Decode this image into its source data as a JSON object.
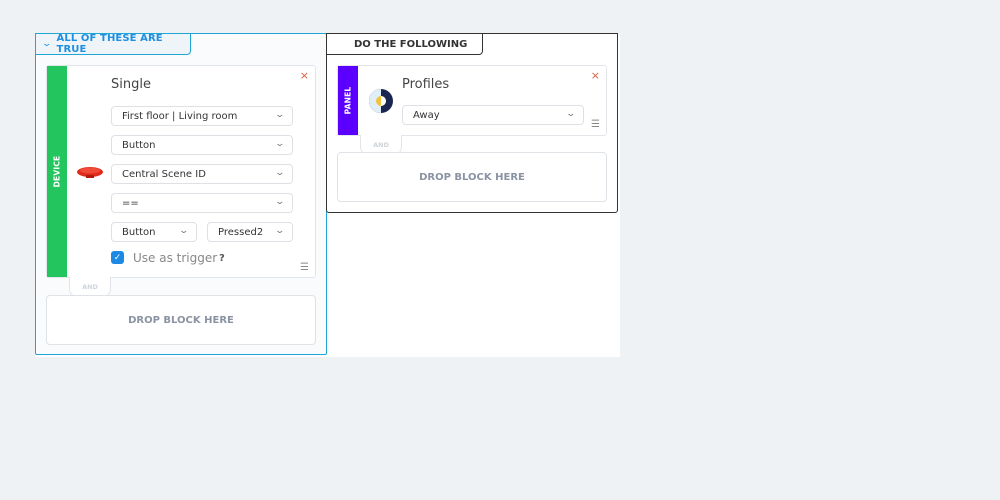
{
  "condition_group": {
    "label": "ALL OF THESE ARE TRUE",
    "toggle_icon": "chevron-down-icon",
    "block": {
      "category": "DEVICE",
      "category_color": "#22c55e",
      "title": "Single",
      "device_icon": "red-button-icon",
      "room_select": "First floor | Living room",
      "type_select": "Button",
      "property_select": "Central Scene ID",
      "operator_select": "==",
      "value_type_select": "Button",
      "value_select": "Pressed2",
      "use_as_trigger_label": "Use as trigger",
      "use_as_trigger_checked": true,
      "help": "?",
      "close": "×",
      "handle": "☰"
    },
    "and_label": "AND",
    "drop_label": "DROP BLOCK HERE"
  },
  "action_group": {
    "label": "DO THE FOLLOWING",
    "block": {
      "category": "PANEL",
      "category_color": "#5b00ff",
      "title": "Profiles",
      "icon": "profiles-icon",
      "profile_select": "Away",
      "close": "×",
      "handle": "☰"
    },
    "and_label": "AND",
    "drop_label": "DROP BLOCK HERE"
  }
}
